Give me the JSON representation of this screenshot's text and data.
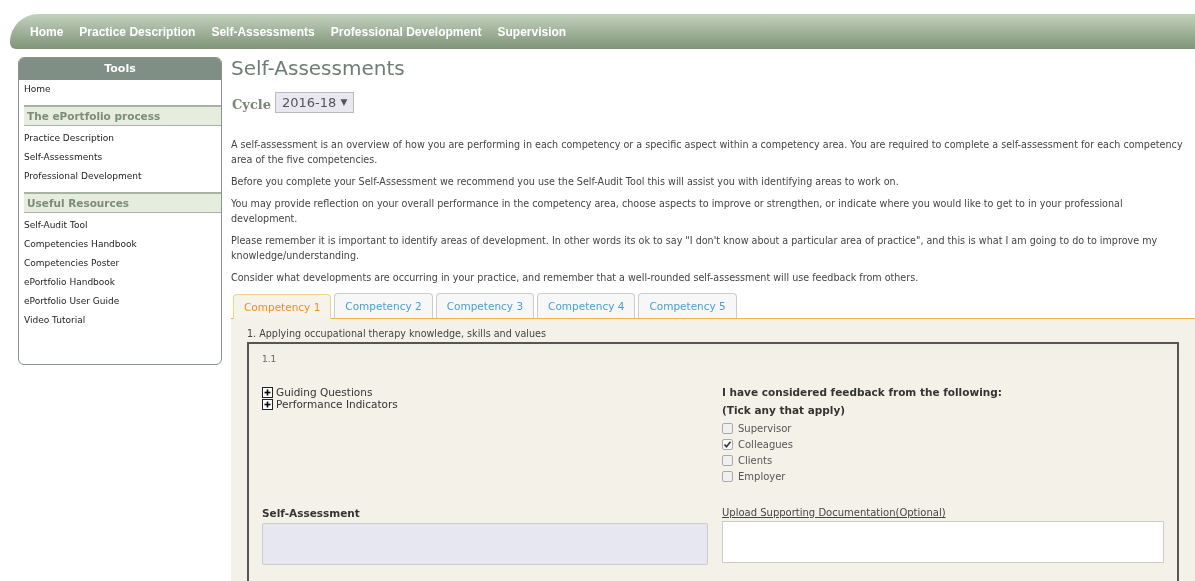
{
  "nav": [
    {
      "label": "Home"
    },
    {
      "label": "Practice Description"
    },
    {
      "label": "Self-Assessments"
    },
    {
      "label": "Professional Development"
    },
    {
      "label": "Supervision"
    }
  ],
  "sidebar": {
    "title": "Tools",
    "items": [
      "Home"
    ],
    "sections": [
      {
        "heading": "The ePortfolio process",
        "items": [
          "Practice Description",
          "Self-Assessments",
          "Professional Development"
        ]
      },
      {
        "heading": "Useful Resources",
        "items": [
          "Self-Audit Tool",
          "Competencies Handbook",
          "Competencies Poster",
          "ePortfolio Handbook",
          "ePortfolio User Guide",
          "Video Tutorial"
        ]
      }
    ]
  },
  "page_title": "Self-Assessments",
  "cycle": {
    "label": "Cycle",
    "value": "2016-18",
    "caret": "▼"
  },
  "paragraphs": [
    "A self-assessment is an overview of how you are performing in each competency or a specific aspect within a competency area. You are required to complete a self-assessment for each competency area of the five competencies.",
    "Before you complete your Self-Assessment we recommend you use the Self-Audit Tool this will assist you with identifying areas to work on.",
    "You may provide reflection on your overall performance in the competency area, choose aspects to improve or strengthen, or indicate where you would like to get to in your professional development.",
    "Please remember it is important to identify areas of development. In other words its ok to say \"I don't know about a particular area of practice\", and this is what I am going to do to improve my knowledge/understanding.",
    "Consider what developments are occurring in your practice, and remember that a well-rounded self-assessment will use feedback from others."
  ],
  "tabs": [
    {
      "label": "Competency 1",
      "selected": true
    },
    {
      "label": "Competency 2",
      "selected": false
    },
    {
      "label": "Competency 3",
      "selected": false
    },
    {
      "label": "Competency 4",
      "selected": false
    },
    {
      "label": "Competency 5",
      "selected": false
    }
  ],
  "competency": {
    "heading": "1. Applying occupational therapy knowledge, skills and values",
    "number": "1.1",
    "expanders": [
      {
        "label": "Guiding Questions",
        "expanded": false
      },
      {
        "label": "Performance Indicators",
        "expanded": false
      }
    ],
    "feedback": {
      "title": "I have considered feedback from the following:",
      "hint": "(Tick any that apply)",
      "options": [
        {
          "label": "Supervisor",
          "checked": false
        },
        {
          "label": "Colleagues",
          "checked": true
        },
        {
          "label": "Clients",
          "checked": false
        },
        {
          "label": "Employer",
          "checked": false
        }
      ]
    },
    "self_assessment_label": "Self-Assessment",
    "upload_link": "Upload Supporting Documentation(Optional)"
  }
}
